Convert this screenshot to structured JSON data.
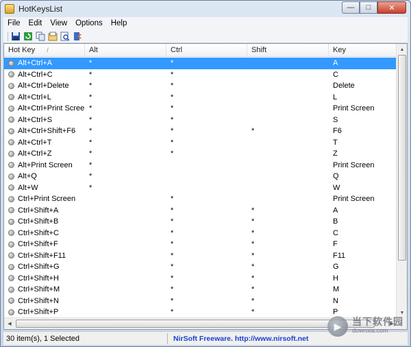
{
  "window": {
    "title": "HotKeysList"
  },
  "window_controls": {
    "minimize": "—",
    "maximize": "□",
    "close": "✕"
  },
  "menu": [
    "File",
    "Edit",
    "View",
    "Options",
    "Help"
  ],
  "toolbar": {
    "buttons": [
      "save-icon",
      "refresh-icon",
      "copy-icon",
      "properties-icon",
      "find-icon",
      "exit-icon"
    ]
  },
  "table": {
    "columns": [
      "Hot Key",
      "Alt",
      "Ctrl",
      "Shift",
      "Key"
    ],
    "sort_indicator": "/",
    "rows": [
      {
        "hotkey": "Alt+Ctrl+A",
        "alt": "*",
        "ctrl": "*",
        "shift": "",
        "key": "A",
        "selected": true
      },
      {
        "hotkey": "Alt+Ctrl+C",
        "alt": "*",
        "ctrl": "*",
        "shift": "",
        "key": "C"
      },
      {
        "hotkey": "Alt+Ctrl+Delete",
        "alt": "*",
        "ctrl": "*",
        "shift": "",
        "key": "Delete"
      },
      {
        "hotkey": "Alt+Ctrl+L",
        "alt": "*",
        "ctrl": "*",
        "shift": "",
        "key": "L"
      },
      {
        "hotkey": "Alt+Ctrl+Print Screen",
        "alt": "*",
        "ctrl": "*",
        "shift": "",
        "key": "Print Screen"
      },
      {
        "hotkey": "Alt+Ctrl+S",
        "alt": "*",
        "ctrl": "*",
        "shift": "",
        "key": "S"
      },
      {
        "hotkey": "Alt+Ctrl+Shift+F6",
        "alt": "*",
        "ctrl": "*",
        "shift": "*",
        "key": "F6"
      },
      {
        "hotkey": "Alt+Ctrl+T",
        "alt": "*",
        "ctrl": "*",
        "shift": "",
        "key": "T"
      },
      {
        "hotkey": "Alt+Ctrl+Z",
        "alt": "*",
        "ctrl": "*",
        "shift": "",
        "key": "Z"
      },
      {
        "hotkey": "Alt+Print Screen",
        "alt": "*",
        "ctrl": "",
        "shift": "",
        "key": "Print Screen"
      },
      {
        "hotkey": "Alt+Q",
        "alt": "*",
        "ctrl": "",
        "shift": "",
        "key": "Q"
      },
      {
        "hotkey": "Alt+W",
        "alt": "*",
        "ctrl": "",
        "shift": "",
        "key": "W"
      },
      {
        "hotkey": "Ctrl+Print Screen",
        "alt": "",
        "ctrl": "*",
        "shift": "",
        "key": "Print Screen"
      },
      {
        "hotkey": "Ctrl+Shift+A",
        "alt": "",
        "ctrl": "*",
        "shift": "*",
        "key": "A"
      },
      {
        "hotkey": "Ctrl+Shift+B",
        "alt": "",
        "ctrl": "*",
        "shift": "*",
        "key": "B"
      },
      {
        "hotkey": "Ctrl+Shift+C",
        "alt": "",
        "ctrl": "*",
        "shift": "*",
        "key": "C"
      },
      {
        "hotkey": "Ctrl+Shift+F",
        "alt": "",
        "ctrl": "*",
        "shift": "*",
        "key": "F"
      },
      {
        "hotkey": "Ctrl+Shift+F11",
        "alt": "",
        "ctrl": "*",
        "shift": "*",
        "key": "F11"
      },
      {
        "hotkey": "Ctrl+Shift+G",
        "alt": "",
        "ctrl": "*",
        "shift": "*",
        "key": "G"
      },
      {
        "hotkey": "Ctrl+Shift+H",
        "alt": "",
        "ctrl": "*",
        "shift": "*",
        "key": "H"
      },
      {
        "hotkey": "Ctrl+Shift+M",
        "alt": "",
        "ctrl": "*",
        "shift": "*",
        "key": "M"
      },
      {
        "hotkey": "Ctrl+Shift+N",
        "alt": "",
        "ctrl": "*",
        "shift": "*",
        "key": "N"
      },
      {
        "hotkey": "Ctrl+Shift+P",
        "alt": "",
        "ctrl": "*",
        "shift": "*",
        "key": "P"
      }
    ]
  },
  "status": {
    "count": "30 item(s), 1 Selected",
    "link": "NirSoft Freeware.  http://www.nirsoft.net"
  },
  "watermark": {
    "text": "当下软件园",
    "url": "downxia.com"
  },
  "colors": {
    "selection": "#3399ff",
    "link": "#1a3fd1"
  }
}
